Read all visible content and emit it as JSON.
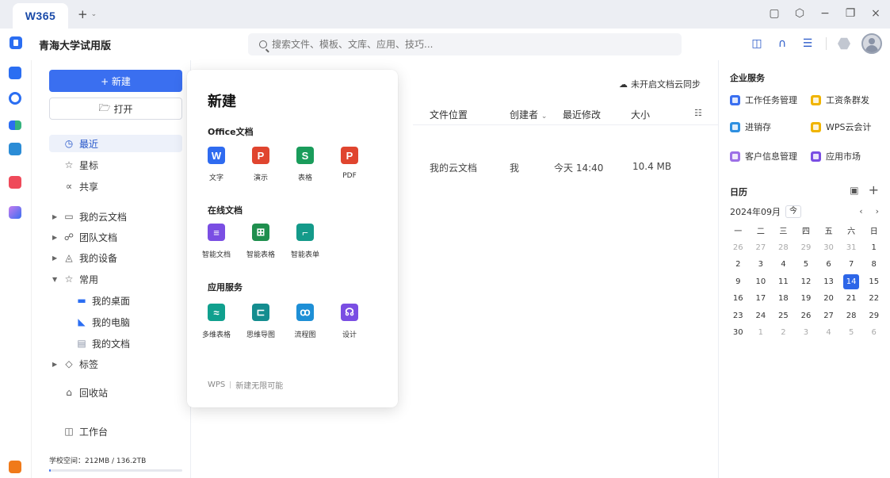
{
  "titlebar": {
    "brand": "W365",
    "new_tab": "+"
  },
  "window_controls": [
    "restore-icon",
    "cube-icon",
    "minimize-icon",
    "maximize-icon",
    "close-icon"
  ],
  "header": {
    "workspace": "青海大学试用版",
    "search_placeholder": "搜索文件、模板、文库、应用、技巧..."
  },
  "sidebar": {
    "new_label": "+ 新建",
    "open_label": "打开",
    "nav": {
      "recent": "最近",
      "starred": "星标",
      "shared": "共享",
      "cloud_docs": "我的云文档",
      "team_docs": "团队文档",
      "devices": "我的设备",
      "common": "常用",
      "desktop": "我的桌面",
      "computer": "我的电脑",
      "documents": "我的文档",
      "tags": "标签",
      "recycle": "回收站",
      "workbench": "工作台"
    },
    "quota_text": "学校空间：212MB / 136.2TB",
    "quota_fraction": 0.0015
  },
  "main": {
    "sync_text": "未开启文档云同步",
    "columns": [
      "文件位置",
      "创建者",
      "最近修改",
      "大小"
    ],
    "row": {
      "location": "我的云文档",
      "creator": "我",
      "modified": "今天 14:40",
      "size": "10.4 MB"
    }
  },
  "popup": {
    "title": "新建",
    "office_section": "Office文档",
    "office_apps": [
      {
        "label": "文字",
        "glyph": "W",
        "color": "#2f6bf0"
      },
      {
        "label": "演示",
        "glyph": "P",
        "color": "#e0452f"
      },
      {
        "label": "表格",
        "glyph": "S",
        "color": "#1a9c5b"
      },
      {
        "label": "PDF",
        "glyph": "P",
        "color": "#e0452f"
      }
    ],
    "online_section": "在线文档",
    "online_apps": [
      {
        "label": "智能文档",
        "glyph": "≡",
        "color": "#7a4ee3"
      },
      {
        "label": "智能表格",
        "glyph": "⊞",
        "color": "#1f8f4e"
      },
      {
        "label": "智能表单",
        "glyph": "⌐",
        "color": "#149a8a"
      }
    ],
    "services_section": "应用服务",
    "service_apps": [
      {
        "label": "多维表格",
        "glyph": "≈",
        "color": "#10a08e"
      },
      {
        "label": "思维导图",
        "glyph": "⊏",
        "color": "#148d8f"
      },
      {
        "label": "流程图",
        "glyph": "ꝏ",
        "color": "#1e8fd6"
      },
      {
        "label": "设计",
        "glyph": "☊",
        "color": "#7a4ee3"
      }
    ],
    "footer_brand": "WPS",
    "footer_slogan": "新建无限可能"
  },
  "right_panel": {
    "enterprise_title": "企业服务",
    "services": [
      {
        "label": "工作任务管理",
        "color": "#3a6ff0"
      },
      {
        "label": "工资条群发",
        "color": "#f0b400"
      },
      {
        "label": "进销存",
        "color": "#2e8fe0"
      },
      {
        "label": "WPS云会计",
        "color": "#f0b400"
      },
      {
        "label": "客户信息管理",
        "color": "#9c6fe6"
      },
      {
        "label": "应用市场",
        "color": "#7a4ee3"
      }
    ],
    "calendar_title": "日历",
    "month_label": "2024年09月",
    "today_label": "今",
    "weekdays": [
      "一",
      "二",
      "三",
      "四",
      "五",
      "六",
      "日"
    ],
    "weeks": [
      [
        "26",
        "27",
        "28",
        "29",
        "30",
        "31",
        "1"
      ],
      [
        "2",
        "3",
        "4",
        "5",
        "6",
        "7",
        "8"
      ],
      [
        "9",
        "10",
        "11",
        "12",
        "13",
        "14",
        "15"
      ],
      [
        "16",
        "17",
        "18",
        "19",
        "20",
        "21",
        "22"
      ],
      [
        "23",
        "24",
        "25",
        "26",
        "27",
        "28",
        "29"
      ],
      [
        "30",
        "1",
        "2",
        "3",
        "4",
        "5",
        "6"
      ]
    ],
    "today_date": "14"
  }
}
